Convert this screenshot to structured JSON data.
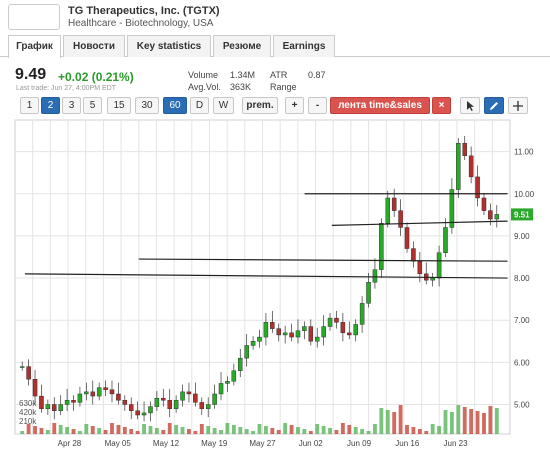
{
  "header": {
    "company": "TG Therapeutics, Inc. (TGTX)",
    "sector": "Healthcare - Biotechnology, USA"
  },
  "tabs": [
    {
      "label": "График",
      "active": true
    },
    {
      "label": "Новости",
      "active": false
    },
    {
      "label": "Key statistics",
      "active": false
    },
    {
      "label": "Резюме",
      "active": false
    },
    {
      "label": "Earnings",
      "active": false
    }
  ],
  "quote": {
    "price": "9.49",
    "change": "+0.02 (0.21%)",
    "last_trade": "Last trade: Jun 27, 4:00PM EDT",
    "volume_label": "Volume",
    "volume_value": "1.34M",
    "avgvol_label": "Avg.Vol.",
    "avgvol_value": "363K",
    "atr_label": "ATR",
    "atr_value": "0.87",
    "range_label": "Range",
    "change_color": "#2a9a2a"
  },
  "toolbar": {
    "periods": [
      "1",
      "2",
      "3",
      "5",
      "15",
      "30",
      "60",
      "D",
      "W"
    ],
    "selected": [
      "2",
      "60"
    ],
    "prem_label": "prem.",
    "plus_label": "+",
    "minus_label": "-",
    "tape_label": "лента time&sales",
    "close_label": "×",
    "cursor_icon": "cursor-arrow-icon",
    "draw_icon": "pencil-icon",
    "crosshair_icon": "crosshair-icon"
  },
  "chart_data": {
    "type": "candlestick",
    "ylim": [
      4.3,
      11.75
    ],
    "y_ticks": [
      "11.00",
      "10.00",
      "9.00",
      "8.00",
      "7.00",
      "6.00",
      "5.00"
    ],
    "x_ticks": [
      "Apr 28",
      "May 05",
      "May 12",
      "May 19",
      "May 27",
      "Jun 02",
      "Jun 09",
      "Jun 16",
      "Jun 23"
    ],
    "volume_ticks": [
      "630k",
      "420k",
      "210k"
    ],
    "last_price_label": "9.51",
    "accent_color": "#2aa82a",
    "closes": [
      5.9,
      5.6,
      5.2,
      4.9,
      5.0,
      4.85,
      5.0,
      5.1,
      5.05,
      5.25,
      5.3,
      5.2,
      5.4,
      5.35,
      5.25,
      5.1,
      5.0,
      4.85,
      4.75,
      4.8,
      4.95,
      5.15,
      5.1,
      4.9,
      5.1,
      5.3,
      5.25,
      5.05,
      4.9,
      5.0,
      5.25,
      5.5,
      5.55,
      5.8,
      6.1,
      6.4,
      6.5,
      6.6,
      6.95,
      6.8,
      6.65,
      6.7,
      6.6,
      6.75,
      6.85,
      6.5,
      6.6,
      6.85,
      7.05,
      6.95,
      6.7,
      6.65,
      6.9,
      7.4,
      7.9,
      8.2,
      9.3,
      9.9,
      9.6,
      9.2,
      8.7,
      8.4,
      8.1,
      7.95,
      8.0,
      8.6,
      9.2,
      10.1,
      11.2,
      10.9,
      10.4,
      9.9,
      9.6,
      9.4,
      9.51
    ],
    "hlines": [
      {
        "y1": 10.0,
        "y2": 10.0,
        "x1": 0.585,
        "x2": 0.995
      },
      {
        "y1": 9.25,
        "y2": 9.35,
        "x1": 0.64,
        "x2": 0.995
      },
      {
        "y1": 8.45,
        "y2": 8.4,
        "x1": 0.25,
        "x2": 0.995
      },
      {
        "y1": 8.1,
        "y2": 8.0,
        "x1": 0.02,
        "x2": 0.995
      }
    ]
  }
}
